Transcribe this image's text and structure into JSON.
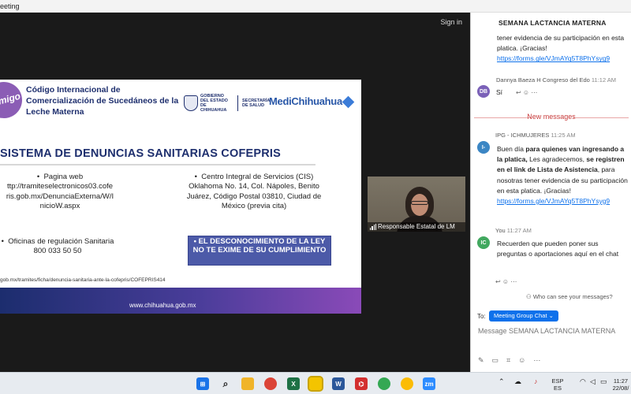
{
  "window": {
    "title": "eeting"
  },
  "meeting": {
    "signin_label": "Sign in"
  },
  "slide": {
    "logo_text": "ta migo",
    "code_title": "Código Internacional de Comercialización de Sucedáneos de la Leche Materna",
    "gob_text": "GOBIERNO DEL ESTADO DE CHIHUAHUA",
    "gob_sec": "SECRETARÍA DE SALUD",
    "medi_brand": "MediChihuahua",
    "main_title": "SISTEMA DE DENUNCIAS SANITARIAS COFEPRIS",
    "web_label": "Pagina web",
    "web_url": "ttp://tramiteselectronicos03.cofe ris.gob.mx/DenunciaExterna/W/I nicioW.aspx",
    "cis_label": "Centro Integral de Servicios (CIS)",
    "cis_address": "Oklahoma No. 14, Col. Nápoles, Benito Juárez, Código Postal 03810, Ciudad de México (previa cita)",
    "reg_label": "Oficinas de regulación Sanitaria",
    "reg_phone": "800 033 50 50",
    "box_text": "EL DESCONOCIMIENTO DE LA LEY NO TE EXIME DE SU CUMPLIMIENTO",
    "bottom_url": "gob.mx/tramites/ficha/denuncia-sanitaria-ante-la-cofepris/COFEPRIS414",
    "footer_url": "www.chihuahua.gob.mx"
  },
  "camera": {
    "participant_name": "Responsable Estatal de LM"
  },
  "chat": {
    "title": "SEMANA LACTANCIA MATERNA",
    "messages": [
      {
        "text": "tener evidencia de su participación en esta platica. ¡Gracias!",
        "link": "https://forms.gle/VJmAYq5T8PhYsyg9"
      },
      {
        "avatar": "DB",
        "sender": "Dannya Baeza H Congreso del Edo",
        "time": "11:12 AM",
        "text": "Sí"
      },
      {
        "avatar": "I-",
        "sender": "IPG - ICHMUJERES",
        "time": "11:25 AM",
        "t1": "Buen día ",
        "b1": "para quienes van ingresando a la platica,",
        "t2": " Les agradecemos, ",
        "b2": "se registren en el link de Lista de Asistencia",
        "t3": ", para nosotras tener evidencia de su participación en esta platica. ¡Gracias!",
        "link": "https://forms.gle/VJmAYq5T8PhYsyg9"
      },
      {
        "avatar": "IC",
        "sender": "You",
        "time": "11:27 AM",
        "text": "Recuerden que pueden poner sus preguntas o aportaciones aquí en el chat"
      }
    ],
    "new_messages_label": "New messages",
    "who_can_see": "Who can see your messages?",
    "to_label": "To:",
    "to_recipient": "Meeting Group Chat",
    "input_placeholder": "Message SEMANA LACTANCIA MATERNA"
  },
  "taskbar": {
    "lang": "ESP",
    "lang_sub": "ES",
    "time": "11:27",
    "date": "22/08/"
  },
  "colors": {
    "accent": "#0e71eb",
    "slide_navy": "#1e2f6e",
    "alert_red": "#c73a3a"
  }
}
